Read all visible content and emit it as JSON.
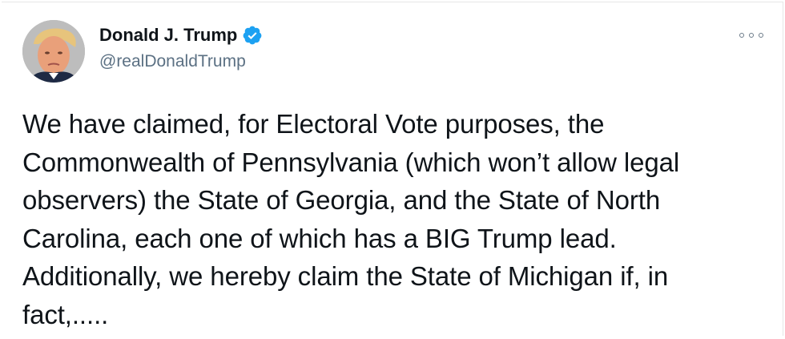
{
  "tweet": {
    "author": {
      "display_name": "Donald J. Trump",
      "handle": "@realDonaldTrump",
      "verified": true,
      "verified_icon": "verified-badge-icon",
      "avatar": "avatar-photo"
    },
    "text_lines": [
      "We have claimed, for Electoral Vote purposes, the",
      "Commonwealth of Pennsylvania (which won’t allow legal",
      "observers) the State of Georgia, and the State of North",
      "Carolina, each one of which has a BIG Trump lead.",
      "Additionally, we hereby claim the State of Michigan if, in",
      "fact,....."
    ],
    "more_icon": "more-options-icon"
  },
  "colors": {
    "text": "#0f1419",
    "secondary_text": "#5b7083",
    "verified": "#1da1f2",
    "background": "#ffffff"
  }
}
